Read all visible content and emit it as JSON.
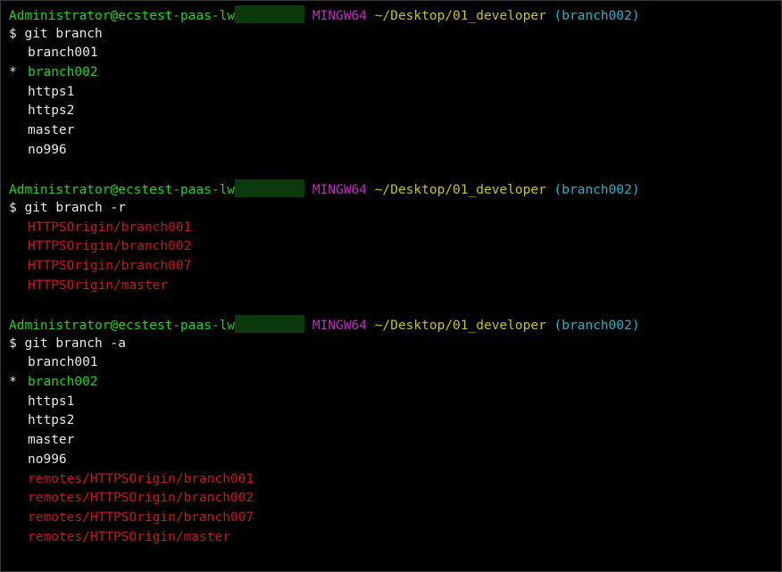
{
  "prompt": {
    "user": "Administrator@ecstest-paas-lw",
    "system": "MINGW64",
    "path": "~/Desktop/01_developer",
    "branch": "(branch002)"
  },
  "blocks": [
    {
      "command": "$ git branch",
      "lines": [
        {
          "marker": "",
          "text": "branch001",
          "kind": "text"
        },
        {
          "marker": "*",
          "text": "branch002",
          "kind": "current"
        },
        {
          "marker": "",
          "text": "https1",
          "kind": "text"
        },
        {
          "marker": "",
          "text": "https2",
          "kind": "text"
        },
        {
          "marker": "",
          "text": "master",
          "kind": "text"
        },
        {
          "marker": "",
          "text": "no996",
          "kind": "text"
        }
      ]
    },
    {
      "command": "$ git branch -r",
      "lines": [
        {
          "marker": "",
          "text": "HTTPSOrigin/branch001",
          "kind": "remote"
        },
        {
          "marker": "",
          "text": "HTTPSOrigin/branch002",
          "kind": "remote"
        },
        {
          "marker": "",
          "text": "HTTPSOrigin/branch007",
          "kind": "remote"
        },
        {
          "marker": "",
          "text": "HTTPSOrigin/master",
          "kind": "remote"
        }
      ]
    },
    {
      "command": "$ git branch -a",
      "lines": [
        {
          "marker": "",
          "text": "branch001",
          "kind": "text"
        },
        {
          "marker": "*",
          "text": "branch002",
          "kind": "current"
        },
        {
          "marker": "",
          "text": "https1",
          "kind": "text"
        },
        {
          "marker": "",
          "text": "https2",
          "kind": "text"
        },
        {
          "marker": "",
          "text": "master",
          "kind": "text"
        },
        {
          "marker": "",
          "text": "no996",
          "kind": "text"
        },
        {
          "marker": "",
          "text": "remotes/HTTPSOrigin/branch001",
          "kind": "remote"
        },
        {
          "marker": "",
          "text": "remotes/HTTPSOrigin/branch002",
          "kind": "remote"
        },
        {
          "marker": "",
          "text": "remotes/HTTPSOrigin/branch007",
          "kind": "remote"
        },
        {
          "marker": "",
          "text": "remotes/HTTPSOrigin/master",
          "kind": "remote"
        }
      ]
    }
  ],
  "colors": {
    "background": "#000000",
    "user": "#1fd61f",
    "system": "#c42ac4",
    "path": "#c9c21a",
    "branch": "#27b3c9",
    "current_branch": "#1fd61f",
    "remote_branch": "#c41a1a",
    "text": "#e8e8e8",
    "redaction": "#0c3a0c"
  }
}
